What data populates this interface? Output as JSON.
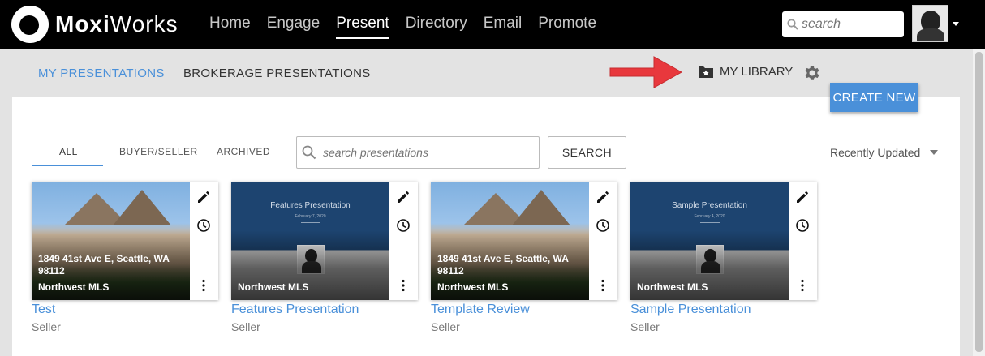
{
  "header": {
    "logo": {
      "bold": "Moxi",
      "regular": "Works"
    },
    "nav": [
      "Home",
      "Engage",
      "Present",
      "Directory",
      "Email",
      "Promote"
    ],
    "active_nav": "Present",
    "search_placeholder": "search"
  },
  "subnav": {
    "tabs": [
      "MY PRESENTATIONS",
      "BROKERAGE PRESENTATIONS"
    ],
    "library_label": "MY LIBRARY",
    "create_label": "CREATE NEW"
  },
  "filters": {
    "tabs": [
      "ALL",
      "BUYER/SELLER",
      "ARCHIVED"
    ],
    "search_placeholder": "search presentations",
    "search_button": "SEARCH",
    "sort_label": "Recently Updated"
  },
  "cards": [
    {
      "title": "Test",
      "subtitle": "Seller",
      "address": "1849 41st Ave E, Seattle, WA 98112",
      "source": "Northwest MLS"
    },
    {
      "title": "Features Presentation",
      "subtitle": "Seller",
      "slide_title": "Features Presentation",
      "slide_date": "February 7, 2020",
      "source": "Northwest MLS"
    },
    {
      "title": "Template Review",
      "subtitle": "Seller",
      "address": "1849 41st Ave E, Seattle, WA 98112",
      "source": "Northwest MLS"
    },
    {
      "title": "Sample Presentation",
      "subtitle": "Seller",
      "slide_title": "Sample Presentation",
      "slide_date": "February 4, 2020",
      "source": "Northwest MLS"
    }
  ],
  "colors": {
    "accent": "#4a90d9",
    "header_bg": "#000000",
    "arrow": "#e8383d",
    "slide_bg": "#1d4470"
  }
}
